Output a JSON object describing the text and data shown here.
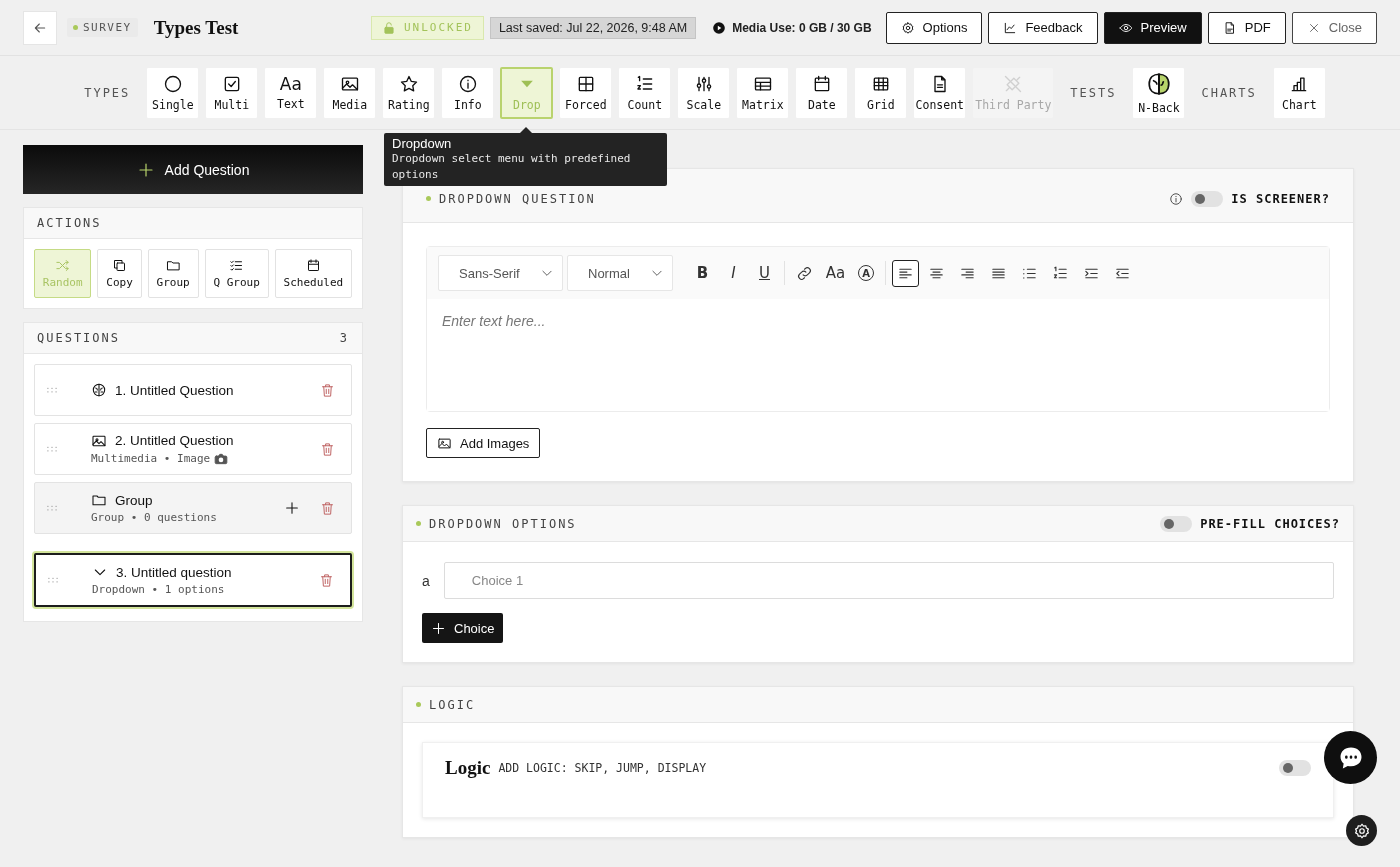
{
  "header": {
    "badge": "SURVEY",
    "title": "Types Test",
    "lock": "UNLOCKED",
    "saved": "Last saved: Jul 22, 2026, 9:48 AM",
    "media": "Media Use: 0 GB / 30 GB",
    "buttons": [
      {
        "label": "Options",
        "kind": "options"
      },
      {
        "label": "Feedback",
        "kind": "feedback"
      },
      {
        "label": "Preview",
        "kind": "preview"
      },
      {
        "label": "PDF",
        "kind": "pdf"
      },
      {
        "label": "Close",
        "kind": "close"
      }
    ]
  },
  "toolbar": {
    "groups": [
      {
        "label": "TYPES",
        "items": [
          {
            "label": "Single",
            "kind": "single",
            "selected": false,
            "disabled": false
          },
          {
            "label": "Multi",
            "kind": "multi",
            "selected": false,
            "disabled": false
          },
          {
            "label": "Text",
            "kind": "text",
            "glyph": "Aa",
            "selected": false,
            "disabled": false
          },
          {
            "label": "Media",
            "kind": "media",
            "selected": false,
            "disabled": false
          },
          {
            "label": "Rating",
            "kind": "rating",
            "selected": false,
            "disabled": false
          },
          {
            "label": "Info",
            "kind": "info",
            "selected": false,
            "disabled": false
          },
          {
            "label": "Drop",
            "kind": "dropdown",
            "selected": true,
            "disabled": false
          },
          {
            "label": "Forced",
            "kind": "forced",
            "selected": false,
            "disabled": false
          },
          {
            "label": "Count",
            "kind": "count",
            "selected": false,
            "disabled": false
          },
          {
            "label": "Scale",
            "kind": "scale",
            "selected": false,
            "disabled": false
          },
          {
            "label": "Matrix",
            "kind": "matrix",
            "selected": false,
            "disabled": false
          },
          {
            "label": "Date",
            "kind": "date",
            "selected": false,
            "disabled": false
          },
          {
            "label": "Grid",
            "kind": "grid",
            "selected": false,
            "disabled": false
          },
          {
            "label": "Consent",
            "kind": "consent",
            "selected": false,
            "disabled": false
          },
          {
            "label": "Third Party",
            "kind": "thirdparty",
            "selected": false,
            "disabled": true
          }
        ]
      },
      {
        "label": "TESTS",
        "items": [
          {
            "label": "N-Back",
            "kind": "nback",
            "selected": false,
            "disabled": false
          }
        ]
      },
      {
        "label": "CHARTS",
        "items": [
          {
            "label": "Chart",
            "kind": "chart",
            "selected": false,
            "disabled": false
          }
        ]
      }
    ]
  },
  "tooltip": {
    "title": "Dropdown",
    "text": "Dropdown select menu with predefined options"
  },
  "sidebar": {
    "add_label": "Add Question",
    "actions": {
      "title": "ACTIONS",
      "items": [
        {
          "label": "Random",
          "kind": "random",
          "selected": true
        },
        {
          "label": "Copy",
          "kind": "copy",
          "selected": false
        },
        {
          "label": "Group",
          "kind": "group",
          "selected": false
        },
        {
          "label": "Q Group",
          "kind": "qgroup",
          "selected": false
        },
        {
          "label": "Scheduled",
          "kind": "scheduled",
          "selected": false
        }
      ]
    },
    "questions": {
      "title": "QUESTIONS",
      "count": "3",
      "items": [
        {
          "kind": "nback",
          "title": "1. Untitled Question",
          "selected": false
        },
        {
          "kind": "media",
          "title": "2. Untitled Question",
          "subtitle": "Multimedia • Image",
          "selected": false
        },
        {
          "kind": "group",
          "title": "Group",
          "subtitle": "Group • 0 questions",
          "selected": false
        },
        {
          "kind": "dropdown",
          "title": "3. Untitled question",
          "subtitle": "Dropdown • 1 options",
          "selected": true
        }
      ]
    }
  },
  "question_panel": {
    "title": "DROPDOWN QUESTION",
    "screener": {
      "label": "IS SCREENER?",
      "on": false
    },
    "editor": {
      "font": "Sans-Serif",
      "size": "Normal",
      "placeholder": "Enter text here...",
      "tools": [
        {
          "kind": "bold",
          "glyph": "B",
          "selected": false
        },
        {
          "kind": "italic",
          "glyph": "I",
          "selected": false
        },
        {
          "kind": "underline",
          "glyph": "U",
          "selected": false
        },
        {
          "kind": "link",
          "selected": false
        },
        {
          "kind": "size",
          "glyph": "Aa",
          "selected": false
        },
        {
          "kind": "color",
          "glyph": "A",
          "selected": false
        },
        {
          "kind": "align-left",
          "selected": true
        },
        {
          "kind": "align-center",
          "selected": false
        },
        {
          "kind": "align-right",
          "selected": false
        },
        {
          "kind": "align-justify",
          "selected": false
        },
        {
          "kind": "bullet-list",
          "selected": false
        },
        {
          "kind": "numbered-list",
          "selected": false
        },
        {
          "kind": "indent",
          "selected": false
        },
        {
          "kind": "outdent",
          "selected": false
        }
      ]
    },
    "add_images": "Add Images"
  },
  "options_panel": {
    "title": "DROPDOWN OPTIONS",
    "prefill": {
      "label": "PRE-FILL CHOICES?",
      "on": false
    },
    "choices": [
      {
        "letter": "a",
        "placeholder": "Choice 1"
      }
    ],
    "add_label": "Choice"
  },
  "logic_panel": {
    "title": "LOGIC",
    "card": {
      "title": "Logic",
      "subtitle": "ADD LOGIC: SKIP, JUMP, DISPLAY",
      "on": false
    }
  }
}
